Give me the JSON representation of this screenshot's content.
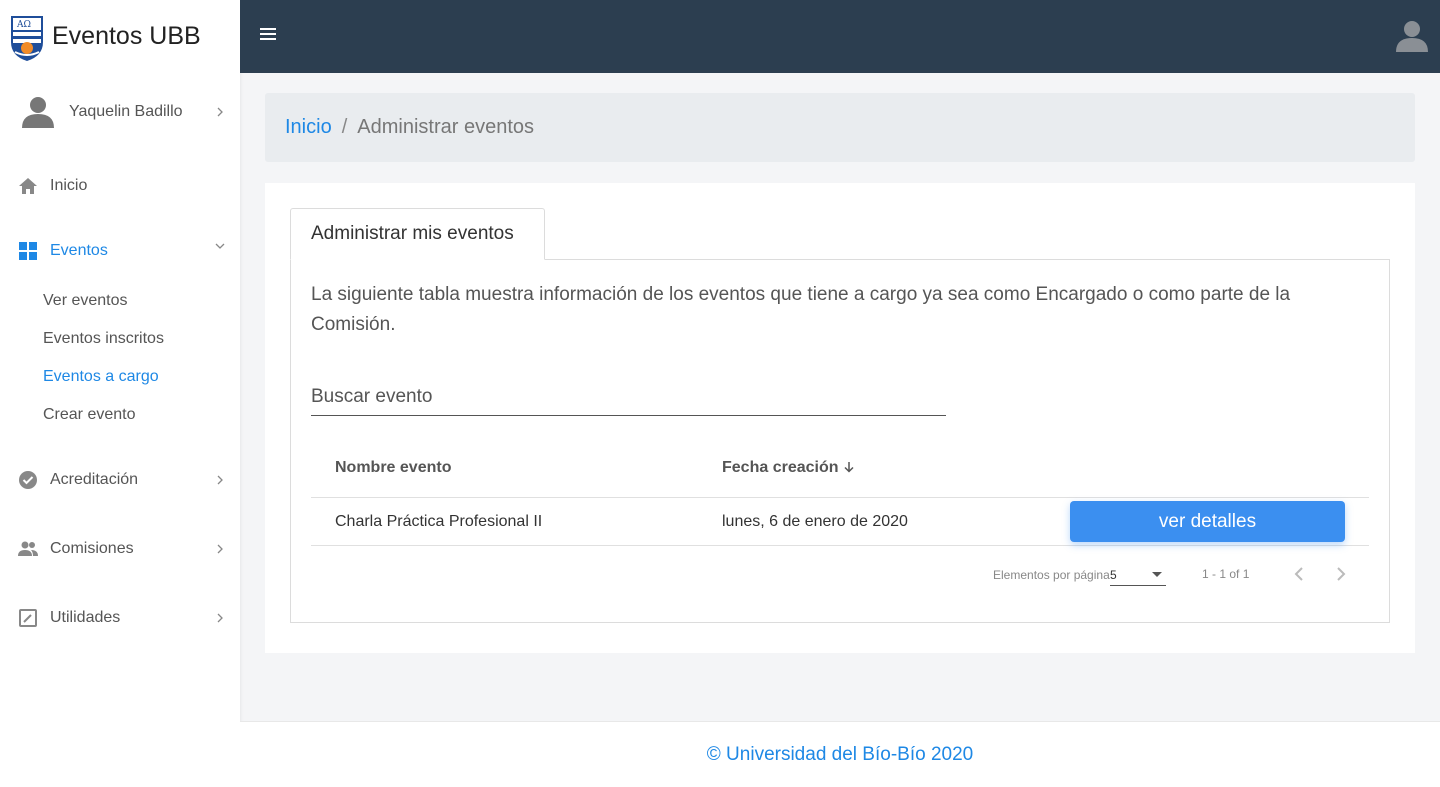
{
  "brand": {
    "title": "Eventos UBB"
  },
  "user": {
    "name": "Yaquelin Badillo"
  },
  "sidebar": {
    "items": [
      {
        "label": "Inicio",
        "icon": "home-icon"
      },
      {
        "label": "Eventos",
        "icon": "grid-icon",
        "submenu": [
          "Ver eventos",
          "Eventos inscritos",
          "Eventos a cargo",
          "Crear evento"
        ]
      },
      {
        "label": "Acreditación",
        "icon": "check-circle-icon"
      },
      {
        "label": "Comisiones",
        "icon": "people-icon"
      },
      {
        "label": "Utilidades",
        "icon": "edit-square-icon"
      }
    ]
  },
  "breadcrumb": {
    "home": "Inicio",
    "separator": "/",
    "current": "Administrar eventos"
  },
  "tab": {
    "label": "Administrar mis eventos"
  },
  "description": "La siguiente tabla muestra información de los eventos que tiene a cargo ya sea como Encargado o como parte de la Comisión.",
  "search": {
    "placeholder": "Buscar evento"
  },
  "table": {
    "headers": [
      "Nombre evento",
      "Fecha creación"
    ],
    "rows": [
      {
        "name": "Charla Práctica Profesional II",
        "date": "lunes, 6 de enero de 2020",
        "action": "ver detalles"
      }
    ]
  },
  "paginator": {
    "label": "Elementos por página",
    "page_size": "5",
    "range": "1 - 1 of 1"
  },
  "footer": {
    "text": "© Universidad del Bío-Bío 2020"
  },
  "colors": {
    "accent": "#1e88e5",
    "topbar": "#2c3e50",
    "button": "#3b8ff0"
  }
}
